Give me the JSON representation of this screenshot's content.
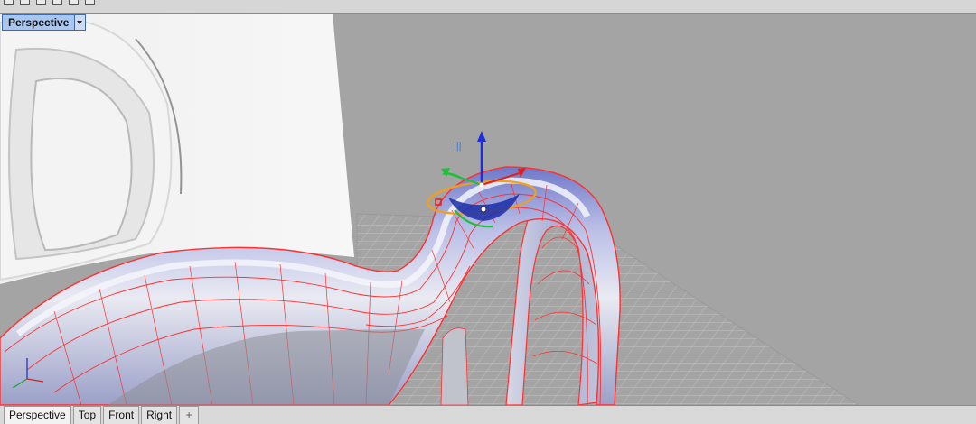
{
  "viewport": {
    "active_label": "Perspective",
    "dropdown_icon": "triangle-down-icon"
  },
  "gumball": {
    "icon": "gumball-gizmo-icon",
    "label": "|||"
  },
  "tabs": [
    {
      "label": "Perspective",
      "active": true
    },
    {
      "label": "Top",
      "active": false
    },
    {
      "label": "Front",
      "active": false
    },
    {
      "label": "Right",
      "active": false
    }
  ],
  "add_tab": {
    "label": "+",
    "icon": "add-viewport-icon"
  },
  "colors": {
    "viewport_bg": "#a4a4a4",
    "selection_edge": "#ff3030",
    "label_active": "#a9c6f0"
  }
}
